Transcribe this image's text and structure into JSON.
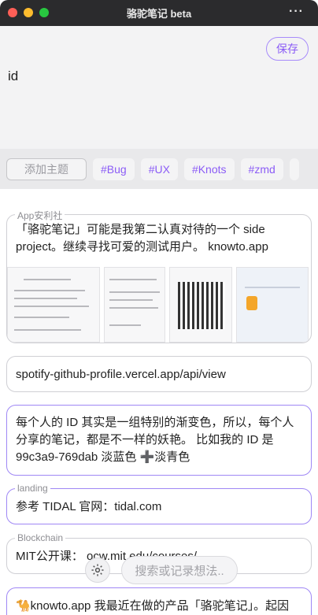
{
  "window": {
    "title": "骆驼笔记 beta"
  },
  "editor": {
    "save_label": "保存",
    "content": "id"
  },
  "tagbar": {
    "add_topic_label": "添加主题",
    "tags": [
      "#Bug",
      "#UX",
      "#Knots",
      "#zmd"
    ]
  },
  "notes": [
    {
      "label": "App安利社",
      "text": "「骆驼笔记」可能是我第二认真对待的一个 side project。继续寻找可爱的测试用户。 knowto.app"
    },
    {
      "label": "",
      "text": "spotify-github-profile.vercel.app/api/view"
    },
    {
      "label": "",
      "text": "每个人的 ID 其实是一组特别的渐变色，所以，每个人分享的笔记，都是不一样的妖艳。 比如我的 ID 是 99c3a9-769dab 淡蓝色 ➕淡青色"
    },
    {
      "label": "landing",
      "text": "参考 TIDAL 官网：tidal.com"
    },
    {
      "label": "Blockchain",
      "text": "MIT公开课： ocw.mit.edu/courses/"
    },
    {
      "label": "",
      "text": "🐪knowto.app 我最近在做的产品「骆驼笔记」。起因"
    }
  ],
  "bottom": {
    "search_placeholder": "搜索或记录想法..",
    "gear_icon": "gear-icon"
  }
}
